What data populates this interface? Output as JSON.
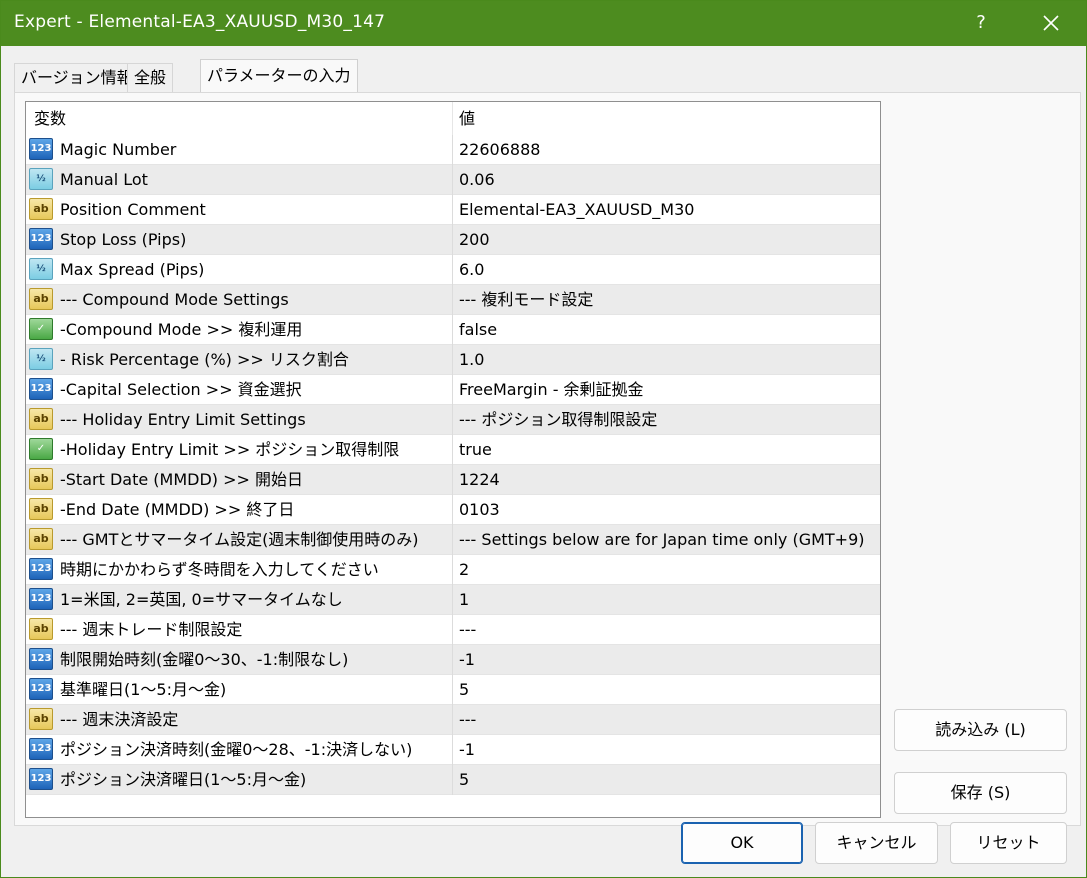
{
  "window": {
    "title": "Expert - Elemental-EA3_XAUUSD_M30_147",
    "help_label": "?"
  },
  "tabs": [
    {
      "label": "バージョン情報"
    },
    {
      "label": "全般"
    },
    {
      "label": "パラメーターの入力"
    }
  ],
  "table": {
    "headers": {
      "name": "変数",
      "value": "値"
    },
    "rows": [
      {
        "type": "int",
        "icon": "123",
        "name": "Magic Number",
        "value": "22606888"
      },
      {
        "type": "dbl",
        "icon": "½",
        "name": "Manual Lot",
        "value": "0.06"
      },
      {
        "type": "str",
        "icon": "ab",
        "name": "Position Comment",
        "value": "Elemental-EA3_XAUUSD_M30"
      },
      {
        "type": "int",
        "icon": "123",
        "name": "Stop Loss (Pips)",
        "value": "200"
      },
      {
        "type": "dbl",
        "icon": "½",
        "name": "Max Spread (Pips)",
        "value": "6.0"
      },
      {
        "type": "str",
        "icon": "ab",
        "name": "--- Compound Mode Settings",
        "value": "--- 複利モード設定"
      },
      {
        "type": "bool",
        "icon": "✓",
        "name": "-Compound Mode >> 複利運用",
        "value": "false"
      },
      {
        "type": "dbl",
        "icon": "½",
        "name": "- Risk Percentage (%) >> リスク割合",
        "value": "1.0"
      },
      {
        "type": "int",
        "icon": "123",
        "name": "-Capital Selection >> 資金選択",
        "value": "FreeMargin - 余剰証拠金"
      },
      {
        "type": "str",
        "icon": "ab",
        "name": "--- Holiday Entry Limit Settings",
        "value": "--- ポジション取得制限設定"
      },
      {
        "type": "bool",
        "icon": "✓",
        "name": "-Holiday Entry Limit >> ポジション取得制限",
        "value": "true"
      },
      {
        "type": "str",
        "icon": "ab",
        "name": "-Start Date (MMDD) >> 開始日",
        "value": "1224"
      },
      {
        "type": "str",
        "icon": "ab",
        "name": "-End Date (MMDD) >> 終了日",
        "value": "0103"
      },
      {
        "type": "str",
        "icon": "ab",
        "name": "--- GMTとサマータイム設定(週末制御使用時のみ)",
        "value": "--- Settings below are for Japan time only (GMT+9)"
      },
      {
        "type": "int",
        "icon": "123",
        "name": "時期にかかわらず冬時間を入力してください",
        "value": "2"
      },
      {
        "type": "int",
        "icon": "123",
        "name": "1=米国, 2=英国, 0=サマータイムなし",
        "value": "1"
      },
      {
        "type": "str",
        "icon": "ab",
        "name": "--- 週末トレード制限設定",
        "value": "---"
      },
      {
        "type": "int",
        "icon": "123",
        "name": "制限開始時刻(金曜0〜30、-1:制限なし)",
        "value": "-1"
      },
      {
        "type": "int",
        "icon": "123",
        "name": "基準曜日(1〜5:月〜金)",
        "value": "5"
      },
      {
        "type": "str",
        "icon": "ab",
        "name": "--- 週末決済設定",
        "value": "---"
      },
      {
        "type": "int",
        "icon": "123",
        "name": "ポジション決済時刻(金曜0〜28、-1:決済しない)",
        "value": "-1"
      },
      {
        "type": "int",
        "icon": "123",
        "name": "ポジション決済曜日(1〜5:月〜金)",
        "value": "5"
      }
    ]
  },
  "buttons": {
    "load": "読み込み (L)",
    "save": "保存 (S)",
    "ok": "OK",
    "cancel": "キャンセル",
    "reset": "リセット"
  }
}
